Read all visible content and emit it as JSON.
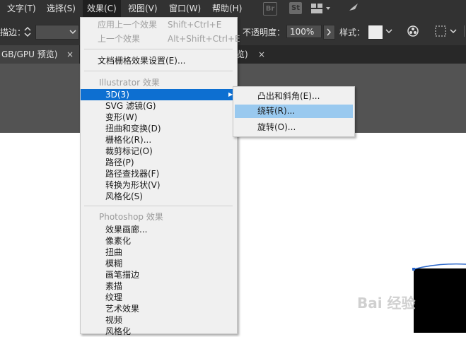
{
  "menubar": {
    "items": [
      "文字(T)",
      "选择(S)",
      "效果(C)",
      "视图(V)",
      "窗口(W)",
      "帮助(H)"
    ],
    "app_icons": [
      "Br",
      "St"
    ]
  },
  "controlbar": {
    "stroke_label": "描边：",
    "opacity_label": "不透明度：",
    "opacity_value": "100%",
    "style_label": "样式："
  },
  "tabs": [
    {
      "label": "GB/GPU 预览)",
      "close": "×"
    },
    {
      "label": "览)",
      "close": "×"
    }
  ],
  "effect_menu": {
    "apply_last": {
      "label": "应用上一个效果",
      "shortcut": "Shift+Ctrl+E"
    },
    "last_effect": {
      "label": "上一个效果",
      "shortcut": "Alt+Shift+Ctrl+E"
    },
    "raster_settings": "文档栅格效果设置(E)...",
    "illustrator_header": "Illustrator 效果",
    "illustrator_items": [
      "3D(3)",
      "SVG 滤镜(G)",
      "变形(W)",
      "扭曲和变换(D)",
      "栅格化(R)...",
      "裁剪标记(O)",
      "路径(P)",
      "路径查找器(F)",
      "转换为形状(V)",
      "风格化(S)"
    ],
    "photoshop_header": "Photoshop 效果",
    "photoshop_items": [
      "效果画廊...",
      "像素化",
      "扭曲",
      "模糊",
      "画笔描边",
      "素描",
      "纹理",
      "艺术效果",
      "视频",
      "风格化"
    ]
  },
  "submenu_3d": {
    "items": [
      "凸出和斜角(E)...",
      "绕转(R)...",
      "旋转(O)..."
    ]
  },
  "watermark": "Bai 经验",
  "colors": {
    "menu_highlight": "#0d6fd1",
    "submenu_highlight": "#99c9ef",
    "ui_dark": "#323232"
  }
}
